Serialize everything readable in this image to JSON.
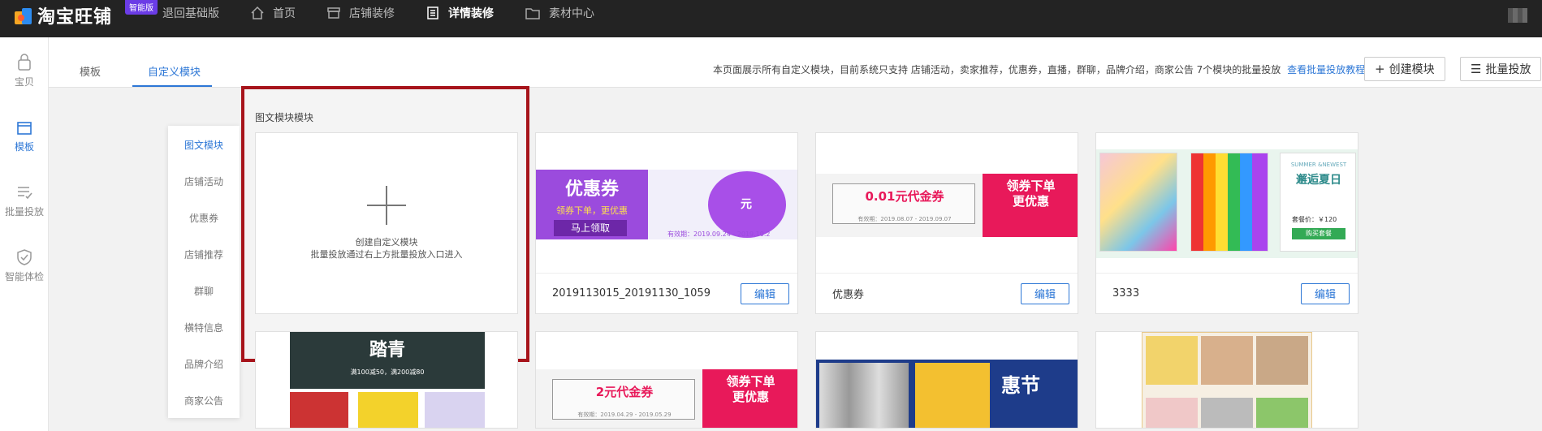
{
  "topbar": {
    "logo_text": "淘宝旺铺",
    "badge": "智能版",
    "nav": [
      {
        "label": "退回基础版",
        "icon": "none"
      },
      {
        "label": "首页",
        "icon": "home-icon"
      },
      {
        "label": "店铺装修",
        "icon": "store-icon"
      },
      {
        "label": "详情装修",
        "icon": "document-icon",
        "active": true
      },
      {
        "label": "素材中心",
        "icon": "folder-icon"
      }
    ]
  },
  "sidebar": {
    "items": [
      {
        "label": "宝贝",
        "icon": "bag-icon"
      },
      {
        "label": "模板",
        "icon": "template-icon",
        "active": true
      },
      {
        "label": "批量投放",
        "icon": "batch-list-icon"
      },
      {
        "label": "智能体检",
        "icon": "shield-check-icon"
      }
    ]
  },
  "tabs": [
    {
      "label": "模板"
    },
    {
      "label": "自定义模块",
      "active": true
    }
  ],
  "notice": {
    "text": "本页面展示所有自定义模块，目前系统只支持 店铺活动，卖家推荐，优惠券，直播，群聊，品牌介绍，商家公告 7个模块的批量投放",
    "link": "查看批量投放教程"
  },
  "actions": {
    "create_label": "创建模块",
    "batch_label": "批量投放"
  },
  "categories": [
    "图文模块",
    "店铺活动",
    "优惠券",
    "店铺推荐",
    "群聊",
    "横特信息",
    "品牌介绍",
    "商家公告"
  ],
  "section": {
    "title": "图文模块模块",
    "create_line1": "创建自定义模块",
    "create_line2": "批量投放通过右上方批量投放入口进入"
  },
  "cards": [
    {
      "name": "2019113015_20191130_1059",
      "edit": "编辑",
      "thumb": {
        "title": "优惠券",
        "sub": "领券下单，更优惠",
        "button": "马上领取",
        "circle": "元",
        "date": "有效期：2019.09.24 - 2019.10.2"
      }
    },
    {
      "name": "优惠券",
      "edit": "编辑",
      "thumb": {
        "amount": "0.01元代金券",
        "date": "有效期：2019.08.07 - 2019.09.07",
        "right": "领券下单\n更优惠"
      }
    },
    {
      "name": "3333",
      "edit": "编辑",
      "thumb": {
        "en": "SUMMER &NEWEST",
        "cn": "邂逅夏日",
        "price": "套餐价：￥120",
        "buy": "购买套餐"
      }
    }
  ],
  "row2": [
    {
      "banner": "踏青",
      "sub": "满100减50，满200减80"
    },
    {
      "amount": "2元代金券",
      "date": "有效期：2019.04.29 - 2019.05.29",
      "right": "领券下单\n更优惠"
    },
    {
      "banner": "惠节"
    },
    {}
  ]
}
